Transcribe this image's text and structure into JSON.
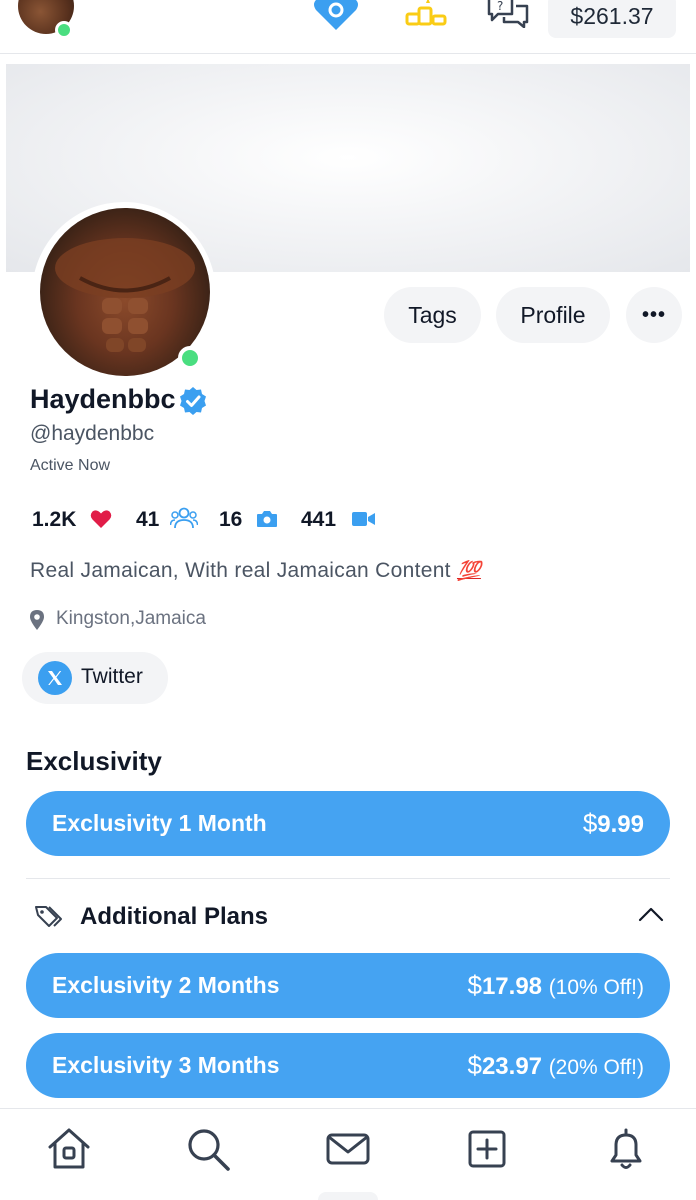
{
  "topbar": {
    "balance": "$261.37",
    "icons": [
      "heart-ticket-icon",
      "podium-icon",
      "question-chat-icon"
    ]
  },
  "profile": {
    "name": "Haydenbbc",
    "handle": "@haydenbbc",
    "status": "Active Now",
    "buttons": {
      "tags": "Tags",
      "profile": "Profile",
      "more": "•••"
    },
    "stats": [
      {
        "value": "1.2K",
        "icon": "heart-icon"
      },
      {
        "value": "41",
        "icon": "users-icon"
      },
      {
        "value": "16",
        "icon": "camera-icon"
      },
      {
        "value": "441",
        "icon": "video-icon"
      }
    ],
    "bio": "Real Jamaican, With real Jamaican Content",
    "bio_emoji": "💯",
    "location": "Kingston,Jamaica",
    "social": {
      "label": "Twitter",
      "icon": "x-logo-icon"
    }
  },
  "exclusivity": {
    "title": "Exclusivity",
    "main_plan": {
      "name": "Exclusivity 1 Month",
      "currency": "$",
      "price": "9.99"
    },
    "additional_title": "Additional Plans",
    "plans": [
      {
        "name": "Exclusivity 2 Months",
        "currency": "$",
        "price": "17.98",
        "discount": "(10% Off!)"
      },
      {
        "name": "Exclusivity 3 Months",
        "currency": "$",
        "price": "23.97",
        "discount": "(20% Off!)"
      }
    ]
  },
  "bottom_nav": [
    "home-icon",
    "search-icon",
    "mail-icon",
    "add-post-icon",
    "bell-icon"
  ],
  "colors": {
    "accent": "#45a3f2",
    "verified": "#3b9ff0",
    "online": "#4ade80",
    "heart": "#e11d48",
    "podium": "#facc15"
  }
}
